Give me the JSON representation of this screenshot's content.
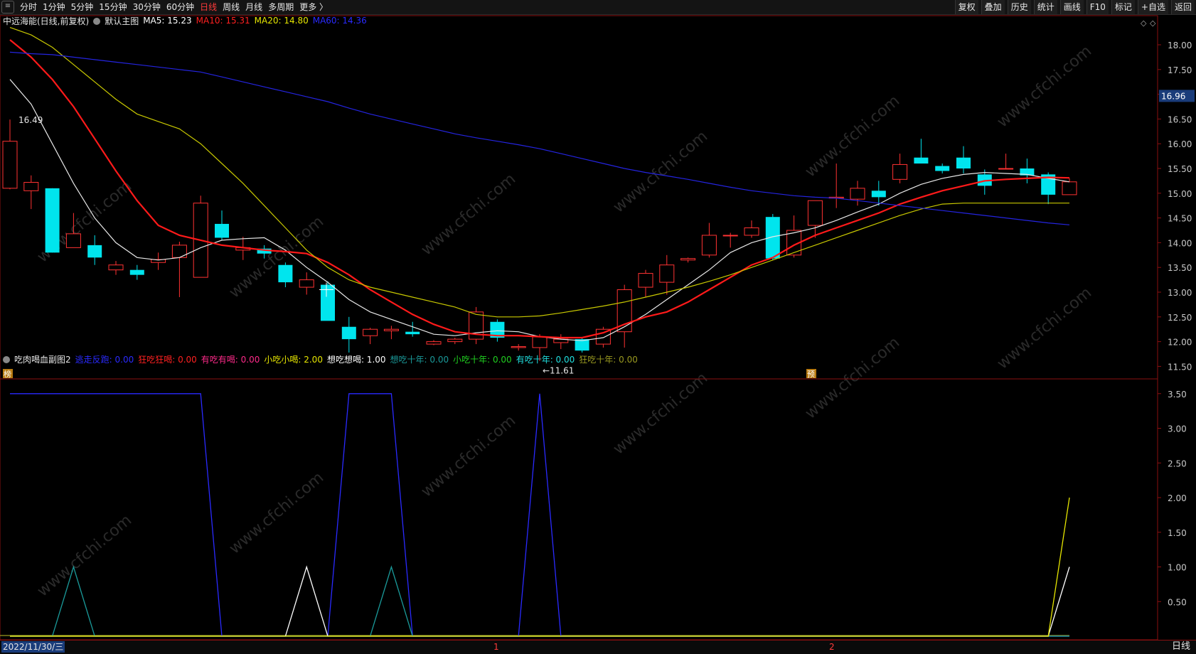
{
  "toolbar": {
    "menu_icon": "menu-icon",
    "periods": [
      "分时",
      "1分钟",
      "5分钟",
      "15分钟",
      "30分钟",
      "60分钟",
      "日线",
      "周线",
      "月线",
      "多周期",
      "更多 〉"
    ],
    "active_period": "日线",
    "right_buttons": [
      "复权",
      "叠加",
      "历史",
      "统计",
      "画线",
      "F10",
      "标记",
      "+自选",
      "返回"
    ]
  },
  "main_chart": {
    "stock_label": "中远海能(日线,前复权)",
    "template_label": "默认主图",
    "ma": [
      {
        "name": "MA5",
        "value": "15.23",
        "color": "#ffffff"
      },
      {
        "name": "MA10",
        "value": "15.31",
        "color": "#ff2020"
      },
      {
        "name": "MA20",
        "value": "14.80",
        "color": "#e6e600"
      },
      {
        "name": "MA60",
        "value": "14.36",
        "color": "#2a2aff"
      }
    ],
    "price_ticks": [
      "18.00",
      "17.50",
      "17.00",
      "16.50",
      "16.00",
      "15.50",
      "15.00",
      "14.50",
      "14.00",
      "13.50",
      "13.00",
      "12.50",
      "12.00",
      "11.50"
    ],
    "current_price": "16.96",
    "high_marker": "16.49",
    "low_marker": "←11.61",
    "badge_left": "榜",
    "badge_mid": "预"
  },
  "sub_chart": {
    "title": "吃肉喝血副图2",
    "indicators": [
      {
        "name": "逃走反跑",
        "value": "0.00",
        "color": "#2a2aff"
      },
      {
        "name": "狂吃狂喝",
        "value": "0.00",
        "color": "#ff2020"
      },
      {
        "name": "有吃有喝",
        "value": "0.00",
        "color": "#ff2a8a"
      },
      {
        "name": "小吃小喝",
        "value": "2.00",
        "color": "#e6e600"
      },
      {
        "name": "想吃想喝",
        "value": "1.00",
        "color": "#ffffff"
      },
      {
        "name": "想吃十年",
        "value": "0.00",
        "color": "#1a9a9a"
      },
      {
        "name": "小吃十年",
        "value": "0.00",
        "color": "#20d020"
      },
      {
        "name": "有吃十年",
        "value": "0.00",
        "color": "#20e0e0"
      },
      {
        "name": "狂吃十年",
        "value": "0.00",
        "color": "#9a9a20"
      }
    ],
    "ticks": [
      "3.50",
      "3.00",
      "2.50",
      "2.00",
      "1.50",
      "1.00",
      "0.50"
    ]
  },
  "status_bar": {
    "date": "2022/11/30/三",
    "month_mark_1": "1",
    "month_mark_2": "2",
    "period": "日线"
  },
  "watermark": "www.cfchi.com",
  "chart_data": {
    "type": "candlestick",
    "title": "中远海能(日线,前复权)",
    "ylim": [
      11.3,
      18.3
    ],
    "candles": [
      {
        "o": 15.1,
        "h": 16.49,
        "l": 15.08,
        "c": 16.05
      },
      {
        "o": 15.05,
        "h": 15.36,
        "l": 14.68,
        "c": 15.22
      },
      {
        "o": 15.1,
        "h": 15.1,
        "l": 13.8,
        "c": 13.8
      },
      {
        "o": 13.9,
        "h": 14.6,
        "l": 13.9,
        "c": 14.18
      },
      {
        "o": 13.95,
        "h": 14.15,
        "l": 13.55,
        "c": 13.7
      },
      {
        "o": 13.45,
        "h": 13.63,
        "l": 13.35,
        "c": 13.55
      },
      {
        "o": 13.45,
        "h": 13.55,
        "l": 13.25,
        "c": 13.35
      },
      {
        "o": 13.6,
        "h": 13.8,
        "l": 13.45,
        "c": 13.66
      },
      {
        "o": 13.7,
        "h": 14.02,
        "l": 12.9,
        "c": 13.95
      },
      {
        "o": 13.3,
        "h": 14.95,
        "l": 13.3,
        "c": 14.8
      },
      {
        "o": 14.38,
        "h": 14.65,
        "l": 14.05,
        "c": 14.1
      },
      {
        "o": 13.85,
        "h": 14.12,
        "l": 13.65,
        "c": 13.9
      },
      {
        "o": 13.88,
        "h": 13.95,
        "l": 13.68,
        "c": 13.78
      },
      {
        "o": 13.55,
        "h": 13.6,
        "l": 13.1,
        "c": 13.2
      },
      {
        "o": 13.1,
        "h": 13.4,
        "l": 12.95,
        "c": 13.25
      },
      {
        "o": 13.15,
        "h": 13.22,
        "l": 12.45,
        "c": 12.42
      },
      {
        "o": 12.3,
        "h": 12.5,
        "l": 11.78,
        "c": 12.05
      },
      {
        "o": 12.12,
        "h": 12.28,
        "l": 11.95,
        "c": 12.25
      },
      {
        "o": 12.22,
        "h": 12.32,
        "l": 12.05,
        "c": 12.25
      },
      {
        "o": 12.2,
        "h": 12.4,
        "l": 12.1,
        "c": 12.15
      },
      {
        "o": 11.95,
        "h": 12.03,
        "l": 11.93,
        "c": 12.0
      },
      {
        "o": 12.0,
        "h": 12.08,
        "l": 11.95,
        "c": 12.05
      },
      {
        "o": 12.05,
        "h": 12.7,
        "l": 11.95,
        "c": 12.6
      },
      {
        "o": 12.4,
        "h": 12.45,
        "l": 12.0,
        "c": 12.08
      },
      {
        "o": 11.88,
        "h": 11.95,
        "l": 11.82,
        "c": 11.9
      },
      {
        "o": 11.88,
        "h": 12.15,
        "l": 11.61,
        "c": 12.1
      },
      {
        "o": 11.98,
        "h": 12.15,
        "l": 11.85,
        "c": 12.05
      },
      {
        "o": 12.05,
        "h": 12.08,
        "l": 11.78,
        "c": 11.82
      },
      {
        "o": 11.95,
        "h": 12.3,
        "l": 11.88,
        "c": 12.25
      },
      {
        "o": 12.2,
        "h": 13.15,
        "l": 11.88,
        "c": 13.05
      },
      {
        "o": 13.1,
        "h": 13.45,
        "l": 12.9,
        "c": 13.38
      },
      {
        "o": 13.2,
        "h": 13.75,
        "l": 12.95,
        "c": 13.55
      },
      {
        "o": 13.65,
        "h": 13.7,
        "l": 13.6,
        "c": 13.68
      },
      {
        "o": 13.75,
        "h": 14.4,
        "l": 13.7,
        "c": 14.15
      },
      {
        "o": 14.15,
        "h": 14.2,
        "l": 13.9,
        "c": 14.15
      },
      {
        "o": 14.15,
        "h": 14.45,
        "l": 14.1,
        "c": 14.3
      },
      {
        "o": 14.52,
        "h": 14.58,
        "l": 13.65,
        "c": 13.68
      },
      {
        "o": 13.75,
        "h": 14.55,
        "l": 13.7,
        "c": 14.25
      },
      {
        "o": 14.35,
        "h": 14.85,
        "l": 14.1,
        "c": 14.85
      },
      {
        "o": 14.9,
        "h": 15.6,
        "l": 14.7,
        "c": 14.92
      },
      {
        "o": 14.88,
        "h": 15.25,
        "l": 14.75,
        "c": 15.1
      },
      {
        "o": 15.05,
        "h": 15.25,
        "l": 14.75,
        "c": 14.92
      },
      {
        "o": 15.28,
        "h": 15.8,
        "l": 15.2,
        "c": 15.58
      },
      {
        "o": 15.72,
        "h": 16.1,
        "l": 15.6,
        "c": 15.6
      },
      {
        "o": 15.55,
        "h": 15.6,
        "l": 15.4,
        "c": 15.45
      },
      {
        "o": 15.72,
        "h": 15.95,
        "l": 15.4,
        "c": 15.5
      },
      {
        "o": 15.38,
        "h": 15.48,
        "l": 14.97,
        "c": 15.15
      },
      {
        "o": 15.5,
        "h": 15.8,
        "l": 15.5,
        "c": 15.5
      },
      {
        "o": 15.5,
        "h": 15.7,
        "l": 15.2,
        "c": 15.36
      },
      {
        "o": 15.38,
        "h": 15.42,
        "l": 14.78,
        "c": 14.97
      },
      {
        "o": 14.97,
        "h": 15.3,
        "l": 14.97,
        "c": 15.23
      }
    ],
    "ma_series": [
      {
        "name": "MA5",
        "color": "#e8e8e8",
        "values": [
          17.3,
          16.8,
          16.0,
          15.2,
          14.5,
          14.0,
          13.7,
          13.65,
          13.7,
          13.9,
          14.05,
          14.08,
          14.1,
          13.85,
          13.5,
          13.2,
          12.85,
          12.6,
          12.45,
          12.3,
          12.15,
          12.12,
          12.18,
          12.22,
          12.2,
          12.1,
          12.05,
          12.02,
          12.08,
          12.3,
          12.55,
          12.85,
          13.15,
          13.45,
          13.8,
          14.0,
          14.12,
          14.2,
          14.3,
          14.45,
          14.62,
          14.78,
          15.0,
          15.18,
          15.3,
          15.38,
          15.42,
          15.4,
          15.38,
          15.3,
          15.23
        ]
      },
      {
        "name": "MA10",
        "color": "#ff1a1a",
        "values": [
          18.1,
          17.75,
          17.3,
          16.75,
          16.1,
          15.45,
          14.85,
          14.35,
          14.15,
          14.05,
          13.95,
          13.9,
          13.85,
          13.82,
          13.78,
          13.6,
          13.35,
          13.05,
          12.8,
          12.55,
          12.35,
          12.2,
          12.15,
          12.12,
          12.12,
          12.1,
          12.08,
          12.08,
          12.18,
          12.35,
          12.5,
          12.6,
          12.8,
          13.05,
          13.3,
          13.55,
          13.7,
          13.95,
          14.15,
          14.3,
          14.45,
          14.6,
          14.78,
          14.92,
          15.05,
          15.15,
          15.25,
          15.28,
          15.3,
          15.32,
          15.31
        ]
      },
      {
        "name": "MA20",
        "color": "#c8c800",
        "values": [
          18.35,
          18.2,
          17.95,
          17.6,
          17.25,
          16.9,
          16.6,
          16.45,
          16.3,
          16.0,
          15.6,
          15.2,
          14.75,
          14.3,
          13.85,
          13.5,
          13.25,
          13.1,
          13.0,
          12.9,
          12.8,
          12.7,
          12.55,
          12.5,
          12.5,
          12.52,
          12.58,
          12.65,
          12.72,
          12.8,
          12.9,
          13.0,
          13.1,
          13.22,
          13.35,
          13.5,
          13.65,
          13.8,
          13.95,
          14.1,
          14.25,
          14.4,
          14.55,
          14.68,
          14.78,
          14.8,
          14.8,
          14.8,
          14.8,
          14.8,
          14.8
        ]
      },
      {
        "name": "MA60",
        "color": "#2424e0",
        "values": [
          17.85,
          17.82,
          17.8,
          17.75,
          17.7,
          17.65,
          17.6,
          17.55,
          17.5,
          17.45,
          17.35,
          17.25,
          17.15,
          17.05,
          16.95,
          16.85,
          16.72,
          16.6,
          16.5,
          16.4,
          16.3,
          16.2,
          16.12,
          16.05,
          15.98,
          15.9,
          15.8,
          15.7,
          15.6,
          15.5,
          15.42,
          15.35,
          15.28,
          15.2,
          15.12,
          15.05,
          15.0,
          14.95,
          14.92,
          14.9,
          14.85,
          14.8,
          14.75,
          14.7,
          14.65,
          14.6,
          14.55,
          14.5,
          14.45,
          14.4,
          14.36
        ]
      }
    ],
    "sub_series": [
      {
        "name": "逃走反跑",
        "color": "#2a2aff",
        "values": [
          3.5,
          3.5,
          3.5,
          3.5,
          3.5,
          3.5,
          3.5,
          3.5,
          3.5,
          3.5,
          0,
          0,
          0,
          0,
          0,
          0,
          3.5,
          3.5,
          3.5,
          0,
          0,
          0,
          0,
          0,
          0,
          3.5,
          0,
          0,
          0,
          0,
          0,
          0,
          0,
          0,
          0,
          0,
          0,
          0,
          0,
          0,
          0,
          0,
          0,
          0,
          0,
          0,
          0,
          0,
          0,
          0,
          0
        ]
      },
      {
        "name": "想吃十年",
        "color": "#1a9a9a",
        "values": [
          0,
          0,
          0,
          1,
          0,
          0,
          0,
          0,
          0,
          0,
          0,
          0,
          0,
          0,
          0,
          0,
          0,
          0,
          1,
          0,
          0,
          0,
          0,
          0,
          0,
          0,
          0,
          0,
          0,
          0,
          0,
          0,
          0,
          0,
          0,
          0,
          0,
          0,
          0,
          0,
          0,
          0,
          0,
          0,
          0,
          0,
          0,
          0,
          0,
          0,
          0
        ]
      },
      {
        "name": "想吃想喝",
        "color": "#ffffff",
        "values": [
          0,
          0,
          0,
          0,
          0,
          0,
          0,
          0,
          0,
          0,
          0,
          0,
          0,
          0,
          1,
          0,
          0,
          0,
          0,
          0,
          0,
          0,
          0,
          0,
          0,
          0,
          0,
          0,
          0,
          0,
          0,
          0,
          0,
          0,
          0,
          0,
          0,
          0,
          0,
          0,
          0,
          0,
          0,
          0,
          0,
          0,
          0,
          0,
          0,
          0,
          1
        ]
      },
      {
        "name": "小吃小喝",
        "color": "#e6e600",
        "values": [
          0,
          0,
          0,
          0,
          0,
          0,
          0,
          0,
          0,
          0,
          0,
          0,
          0,
          0,
          0,
          0,
          0,
          0,
          0,
          0,
          0,
          0,
          0,
          0,
          0,
          0,
          0,
          0,
          0,
          0,
          0,
          0,
          0,
          0,
          0,
          0,
          0,
          0,
          0,
          0,
          0,
          0,
          0,
          0,
          0,
          0,
          0,
          0,
          0,
          0,
          2
        ]
      }
    ],
    "sub_ylim": [
      0,
      3.5
    ]
  }
}
